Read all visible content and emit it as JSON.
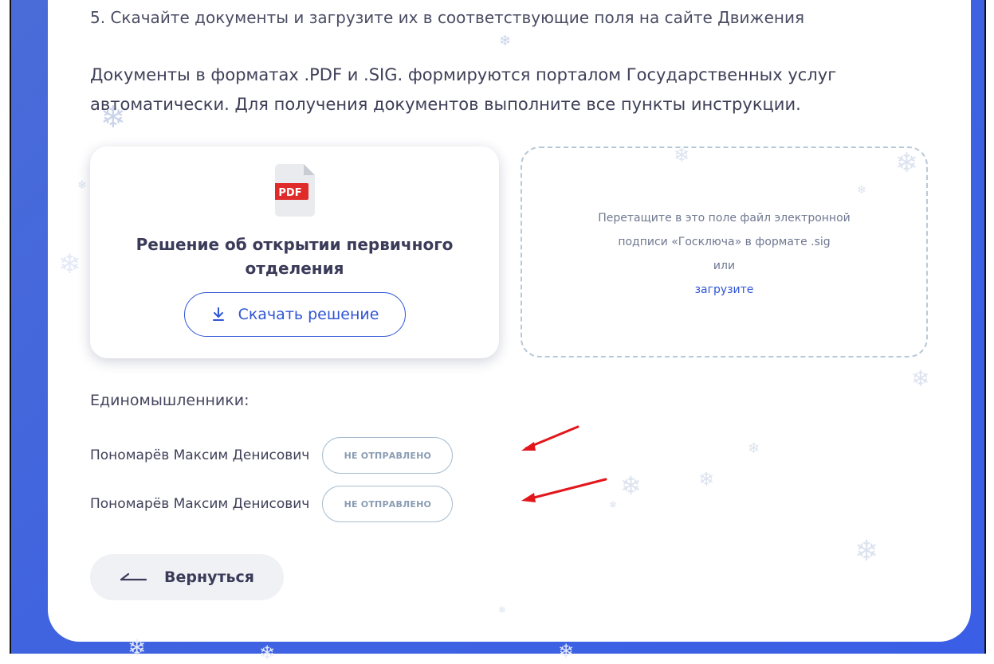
{
  "step": {
    "text": "5. Скачайте документы и загрузите их в соответствующие поля на сайте Движения"
  },
  "info": {
    "text": "Документы в форматах .PDF и .SIG. формируются порталом Государственных услуг автоматически. Для получения документов выполните все пункты инструкции."
  },
  "document": {
    "icon": "pdf-file-icon",
    "icon_label": "PDF",
    "title": "Решение об открытии первичного отделения",
    "download_label": "Скачать решение",
    "download_icon": "download-icon"
  },
  "dropzone": {
    "line1": "Перетащите в это поле файл электронной",
    "line2": "подписи «Госключа» в формате .sig",
    "line3": "или",
    "link": "загрузите"
  },
  "members": {
    "title": "Единомышленники:",
    "items": [
      {
        "name": "Пономарёв Максим Денисович",
        "status": "НЕ ОТПРАВЛЕНО"
      },
      {
        "name": "Пономарёв Максим Денисович",
        "status": "НЕ ОТПРАВЛЕНО"
      }
    ]
  },
  "back": {
    "label": "Вернуться",
    "icon": "arrow-left-icon"
  },
  "colors": {
    "accent": "#2f55d4",
    "background": "#3f63e0",
    "badge_border": "#a7bdd0",
    "annotation_arrow": "#e3161b",
    "pdf_badge": "#e02b2b"
  }
}
